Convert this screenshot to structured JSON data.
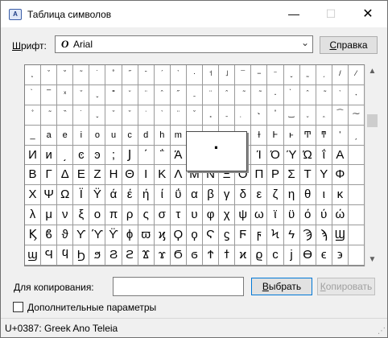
{
  "window": {
    "title": "Таблица символов",
    "icon_label": "A",
    "controls": {
      "minimize": "—",
      "maximize": "☐",
      "close": "✕"
    }
  },
  "font": {
    "label_prefix": "Ш",
    "label_rest": "рифт:",
    "selected": "Arial",
    "type_icon": "O",
    "dropdown_icon": "chevron-down-icon"
  },
  "help_button": {
    "prefix": "",
    "underlined": "С",
    "rest": "правка"
  },
  "grid": {
    "rows": [
      [
        "˛",
        "ˇ",
        "˘",
        "˜",
        "˙",
        "˚",
        "˝",
        "ˉ",
        "ˊ",
        "ˋ",
        "·",
        "˦",
        "˩",
        "¯",
        "−",
        "⁻",
        "ˬ",
        "˷",
        "ˏ",
        "/",
        "⁄"
      ],
      [
        "̀",
        "̅",
        "ˣ",
        "̌",
        "ˬ",
        "˭",
        "̆",
        "̈",
        "ˆ",
        "̋",
        "ˍ",
        "̈",
        "̂",
        "̃",
        "̃",
        "˔",
        "̀",
        "ˆ",
        "̃",
        "ˋ",
        "˖"
      ],
      [
        "̊",
        "̃",
        "̏",
        "˙",
        "ˬ",
        "̌",
        "ˇ",
        "̇",
        "ˋ",
        "̈",
        "ˇ",
        "˳",
        "ˍ",
        "̣",
        "˞",
        "̊",
        "‿",
        "̮",
        "̯",
        "⁀",
        "⁓"
      ],
      [
        "_",
        "a",
        "e",
        "i",
        "o",
        "u",
        "c",
        "d",
        "h",
        "m",
        "",
        "",
        "",
        "",
        "ɫ",
        "Ͱ",
        "ͱ",
        "Ͳ",
        "ͳ",
        "ʹ",
        "͵"
      ],
      [
        "И",
        "и",
        "͵",
        "ͼ",
        "ͽ",
        ";",
        "Ϳ",
        "΄",
        "΅",
        "Ά",
        "·",
        "",
        "",
        "Ή",
        "Ί",
        "Ό",
        "Ύ",
        "Ώ",
        "ΐ",
        "Α",
        ""
      ],
      [
        "Β",
        "Γ",
        "Δ",
        "Ε",
        "Ζ",
        "Η",
        "Θ",
        "Ι",
        "Κ",
        "Λ",
        "Μ",
        "Ν",
        "Ξ",
        "Ο",
        "Π",
        "Ρ",
        "Σ",
        "Τ",
        "Υ",
        "Φ",
        ""
      ],
      [
        "Χ",
        "Ψ",
        "Ω",
        "Ϊ",
        "Ϋ",
        "ά",
        "έ",
        "ή",
        "ί",
        "ΰ",
        "α",
        "β",
        "γ",
        "δ",
        "ε",
        "ζ",
        "η",
        "θ",
        "ι",
        "κ",
        ""
      ],
      [
        "λ",
        "μ",
        "ν",
        "ξ",
        "ο",
        "π",
        "ρ",
        "ς",
        "σ",
        "τ",
        "υ",
        "φ",
        "χ",
        "ψ",
        "ω",
        "ϊ",
        "ϋ",
        "ό",
        "ύ",
        "ώ",
        ""
      ],
      [
        "Ϗ",
        "ϐ",
        "ϑ",
        "ϒ",
        "ϓ",
        "ϔ",
        "ϕ",
        "ϖ",
        "ϗ",
        "Ϙ",
        "ϙ",
        "Ϛ",
        "ϛ",
        "Ϝ",
        "ϝ",
        "Ϟ",
        "ϟ",
        "Ϡ",
        "ϡ",
        "Ϣ",
        ""
      ],
      [
        "ϣ",
        "Ϥ",
        "ϥ",
        "Ϧ",
        "ϧ",
        "Ϩ",
        "ϩ",
        "Ϫ",
        "ϫ",
        "Ϭ",
        "ϭ",
        "Ϯ",
        "ϯ",
        "ϰ",
        "ϱ",
        "ϲ",
        "ϳ",
        "ϴ",
        "ϵ",
        "϶",
        ""
      ]
    ]
  },
  "zoom_popup": {
    "glyph": "·"
  },
  "scrollbar": {
    "up_icon": "▲",
    "down_icon": "▼"
  },
  "copy": {
    "label": "Для копирования:",
    "value": "",
    "select_button": {
      "underlined": "В",
      "rest": "ыбрать"
    },
    "copy_button": {
      "underlined": "К",
      "rest": "опировать"
    }
  },
  "advanced": {
    "checked": false,
    "underlined": "Д",
    "rest": "ополнительные параметры"
  },
  "status": {
    "text": "U+0387: Greek Ano Teleia"
  }
}
